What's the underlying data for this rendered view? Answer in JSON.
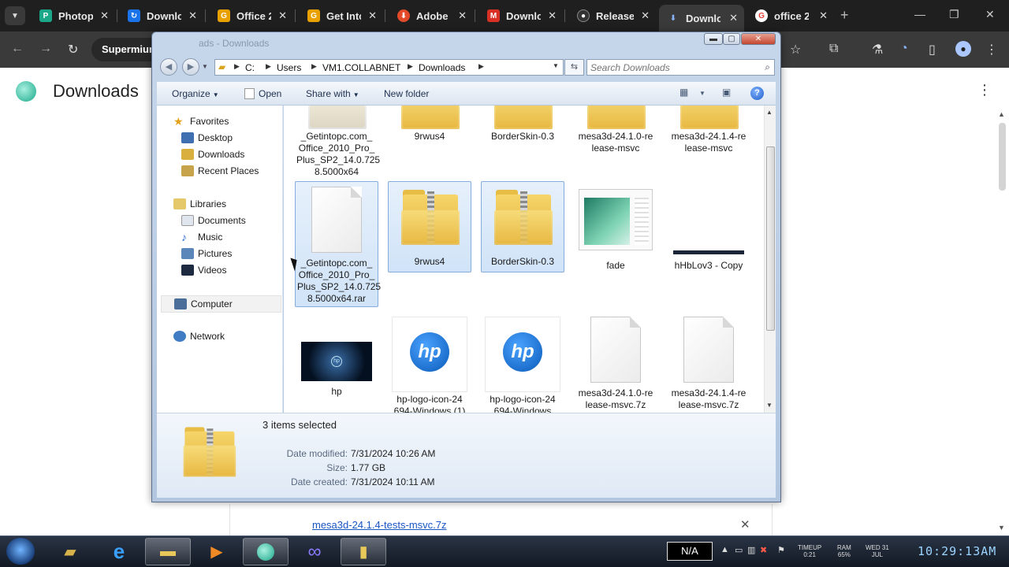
{
  "browser": {
    "tabs": [
      {
        "label": "Photop",
        "favicon_color": "#1aa889",
        "favicon_glyph": "P"
      },
      {
        "label": "Downlo",
        "favicon_color": "#1a73e8",
        "favicon_glyph": "↻"
      },
      {
        "label": "Office 2",
        "favicon_color": "#e8a100",
        "favicon_glyph": "G"
      },
      {
        "label": "Get Into",
        "favicon_color": "#e8a100",
        "favicon_glyph": "G"
      },
      {
        "label": "Adobe",
        "favicon_color": "#e34a2a",
        "favicon_glyph": "⬇"
      },
      {
        "label": "Downlo",
        "favicon_color": "#d93025",
        "favicon_glyph": "M"
      },
      {
        "label": "Release",
        "favicon_color": "#333333",
        "favicon_glyph": "●"
      },
      {
        "label": "Downlo",
        "favicon_color": "#3a3a3a",
        "favicon_glyph": "⬇"
      },
      {
        "label": "office 2",
        "favicon_color": "#ffffff",
        "favicon_glyph": "G"
      }
    ],
    "omnibox_text": "Supermium",
    "page_title": "Downloads",
    "download_link": "mesa3d-24.1.4-tests-msvc.7z"
  },
  "explorer": {
    "title_ghost": "ads - Downloads",
    "breadcrumbs": [
      "C:",
      "Users",
      "VM1.COLLABNET",
      "Downloads"
    ],
    "search_placeholder": "Search Downloads",
    "commands": {
      "organize": "Organize",
      "open": "Open",
      "share": "Share with",
      "new_folder": "New folder"
    },
    "nav": {
      "favorites": "Favorites",
      "desktop": "Desktop",
      "downloads": "Downloads",
      "recent": "Recent Places",
      "libraries": "Libraries",
      "documents": "Documents",
      "music": "Music",
      "pictures": "Pictures",
      "videos": "Videos",
      "computer": "Computer",
      "network": "Network"
    },
    "files_row1": [
      {
        "name": "_Getintopc.com_ Office_2010_Pro_ Plus_SP2_14.0.725 8.5000x64"
      },
      {
        "name": "9rwus4"
      },
      {
        "name": "BorderSkin-0.3"
      },
      {
        "name": "mesa3d-24.1.0-re lease-msvc"
      },
      {
        "name": "mesa3d-24.1.4-re lease-msvc"
      }
    ],
    "files_row2": [
      {
        "name": "_Getintopc.com_ Office_2010_Pro_ Plus_SP2_14.0.725 8.5000x64.rar"
      },
      {
        "name": "9rwus4"
      },
      {
        "name": "BorderSkin-0.3"
      },
      {
        "name": "fade"
      },
      {
        "name": "hHbLov3 - Copy"
      }
    ],
    "files_row3": [
      {
        "name": "hp"
      },
      {
        "name": "hp-logo-icon-24 694-Windows (1)"
      },
      {
        "name": "hp-logo-icon-24 694-Windows"
      },
      {
        "name": "mesa3d-24.1.0-re lease-msvc.7z"
      },
      {
        "name": "mesa3d-24.1.4-re lease-msvc.7z"
      }
    ],
    "hp_logo_text": "hp",
    "details": {
      "summary": "3 items selected",
      "modified_label": "Date modified:",
      "modified_value": "7/31/2024 10:26 AM",
      "size_label": "Size:",
      "size_value": "1.77 GB",
      "created_label": "Date created:",
      "created_value": "7/31/2024 10:11 AM"
    }
  },
  "taskbar": {
    "tray_na": "N/A",
    "timeup_label": "TIMEUP",
    "timeup_value": "0:21",
    "ram_label": "RAM",
    "ram_value": "65%",
    "day": "WED 31",
    "month": "JUL",
    "clock": "10:29:13AM"
  }
}
